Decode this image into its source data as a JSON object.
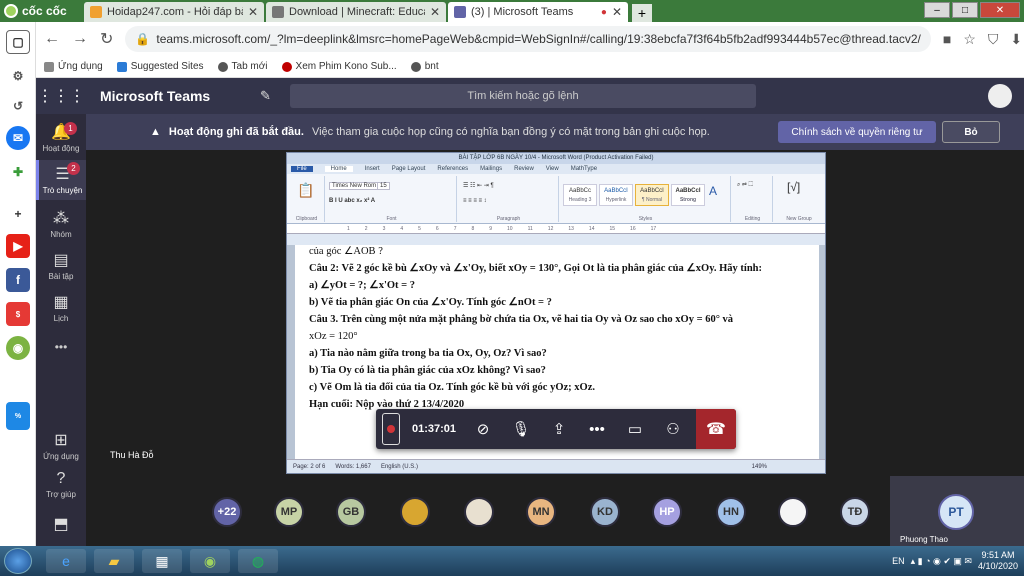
{
  "browser": {
    "brand": "cốc cốc",
    "tabs": [
      {
        "label": "Hoidap247.com - Hỏi đáp bà",
        "icon_color": "#f0a030",
        "active": false
      },
      {
        "label": "Download | Minecraft: Educat",
        "icon_color": "#777777",
        "active": false
      },
      {
        "label": "(3) | Microsoft Teams",
        "icon_color": "#6264a7",
        "active": true
      }
    ],
    "new_tab": "+",
    "url": "teams.microsoft.com/_?lm=deeplink&lmsrc=homePageWeb&cmpid=WebSignIn#/calling/19:38ebcfa7f3f64b5fb2adf993444b57ec@thread.tacv2/",
    "bookmarks": [
      {
        "label": "Ứng dụng",
        "color": "#888888"
      },
      {
        "label": "Suggested Sites",
        "color": "#2b7bd6"
      },
      {
        "label": "Tab mới",
        "color": "#555555"
      },
      {
        "label": "Xem Phim Kono Sub...",
        "color": "#c00000"
      },
      {
        "label": "bnt",
        "color": "#555555"
      }
    ]
  },
  "teams": {
    "app_title": "Microsoft Teams",
    "search_placeholder": "Tìm kiếm hoặc gõ lệnh",
    "rail": [
      {
        "label": "Hoạt động",
        "icon": "bell-icon",
        "badge": "1"
      },
      {
        "label": "Trò chuyện",
        "icon": "chat-icon",
        "badge": "2"
      },
      {
        "label": "Nhóm",
        "icon": "teams-icon",
        "badge": ""
      },
      {
        "label": "Bài tập",
        "icon": "assignments-icon",
        "badge": ""
      },
      {
        "label": "Lịch",
        "icon": "calendar-icon",
        "badge": ""
      },
      {
        "label": "•••",
        "icon": "more-icon",
        "badge": ""
      }
    ],
    "rail_bottom": [
      {
        "label": "Ứng dụng",
        "icon": "apps-icon"
      },
      {
        "label": "Trợ giúp",
        "icon": "help-icon"
      }
    ],
    "banner": {
      "title": "Hoạt động ghi đã bắt đầu.",
      "body": "Việc tham gia cuộc họp cũng có nghĩa bạn đồng ý có mặt trong bản ghi cuộc họp.",
      "privacy_button": "Chính sách về quyền riêng tư",
      "dismiss_button": "Bỏ"
    },
    "presenter_name": "Thu Hà Đỗ",
    "call_timer": "01:37:01",
    "participants": [
      {
        "initials": "+22",
        "color": "#6264a7"
      },
      {
        "initials": "MP",
        "color": "#c7d3a6"
      },
      {
        "initials": "GB",
        "color": "#b7c8a0"
      },
      {
        "initials": "",
        "color": "#d8a630"
      },
      {
        "initials": "",
        "color": "#e8e0d0"
      },
      {
        "initials": "MN",
        "color": "#e8b680"
      },
      {
        "initials": "KD",
        "color": "#9ab3cf"
      },
      {
        "initials": "HP",
        "color": "#a5a0e0"
      },
      {
        "initials": "HN",
        "color": "#a0c0e8"
      },
      {
        "initials": "",
        "color": "#f5f5f5"
      },
      {
        "initials": "TĐ",
        "color": "#c9d6e8"
      }
    ],
    "self_tile": {
      "initials": "PT",
      "name": "Phuong Thao"
    }
  },
  "word": {
    "title": "BÀI TẬP LỚP 6B NGÀY 10/4 - Microsoft Word (Product Activation Failed)",
    "tabs": [
      "File",
      "Home",
      "Insert",
      "Page Layout",
      "References",
      "Mailings",
      "Review",
      "View",
      "MathType"
    ],
    "font_name": "Times New Rom",
    "font_size": "15",
    "groups": [
      "Clipboard",
      "Font",
      "Paragraph",
      "Styles",
      "Editing",
      "New Group"
    ],
    "styles": [
      {
        "sample": "AaBbCc",
        "name": "Heading 3"
      },
      {
        "sample": "AaBbCcI",
        "name": "Hyperlink"
      },
      {
        "sample": "AaBbCcI",
        "name": "¶ Normal"
      },
      {
        "sample": "AaBbCcI",
        "name": "Strong"
      }
    ],
    "lines": [
      "của góc ∠AOB ?",
      "Câu 2: Vẽ 2 góc kề bù ∠xOy và ∠x'Oy, biết xOy = 130°, Gọi Ot là tia phân giác của ∠xOy. Hãy tính:",
      "a) ∠yOt = ?; ∠x'Ot = ?",
      "b) Vẽ tia phân giác On của ∠x'Oy. Tính góc ∠nOt = ?",
      "Câu 3. Trên cùng một nửa mặt phẳng bờ chứa tia Ox, vẽ hai tia Oy và Oz sao cho xOy = 60° và",
      "xOz = 120°",
      "a) Tia nào nằm giữa trong ba tia Ox, Oy, Oz? Vì sao?",
      "b) Tia Oy có là tia phân giác của xOz không? Vì sao?",
      "c) Vẽ Om là tia đối của tia Oz. Tính góc kề bù với góc yOz; xOz.",
      "Hạn cuối: Nộp vào thứ 2 13/4/2020"
    ],
    "status_page": "Page: 2 of 6",
    "status_words": "Words: 1,667",
    "status_lang": "English (U.S.)",
    "zoom": "149%"
  },
  "taskbar": {
    "lang": "EN",
    "time": "9:51 AM",
    "date": "4/10/2020"
  }
}
